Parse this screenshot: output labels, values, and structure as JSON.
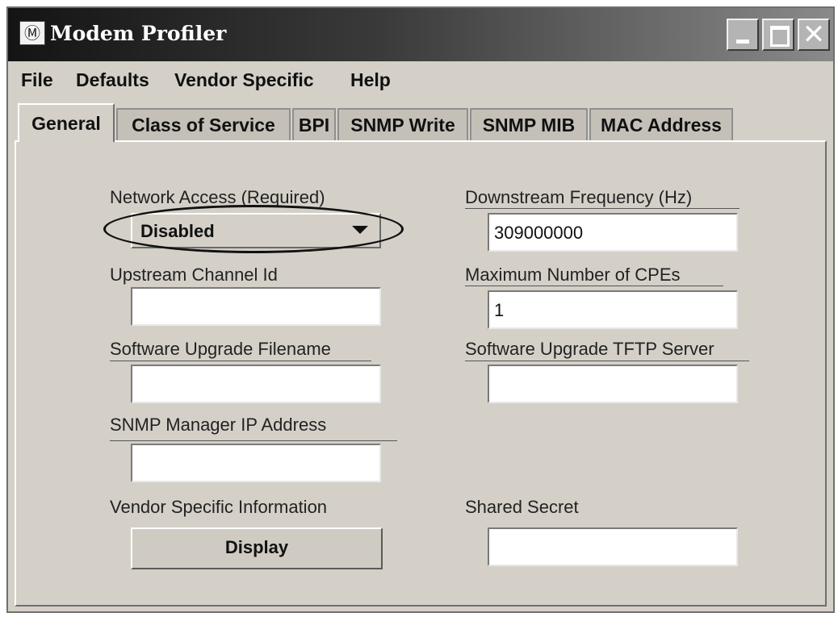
{
  "window": {
    "title": "Modem Profiler",
    "controls": {
      "minimize": "_",
      "maximize": "□",
      "close": "✕"
    },
    "icon": "motorola-logo-icon"
  },
  "menubar": {
    "items": [
      "File",
      "Defaults",
      "Vendor Specific",
      "Help"
    ]
  },
  "tabs": [
    {
      "label": "General",
      "active": true
    },
    {
      "label": "Class of Service",
      "active": false
    },
    {
      "label": "BPI",
      "active": false
    },
    {
      "label": "SNMP Write",
      "active": false
    },
    {
      "label": "SNMP MIB",
      "active": false
    },
    {
      "label": "MAC Address",
      "active": false
    }
  ],
  "general": {
    "network_access": {
      "label": "Network Access (Required)",
      "value": "Disabled",
      "highlighted": true
    },
    "downstream_frequency": {
      "label": "Downstream Frequency (Hz)",
      "value": "309000000"
    },
    "upstream_channel_id": {
      "label": "Upstream Channel Id",
      "value": ""
    },
    "max_cpes": {
      "label": "Maximum Number of CPEs",
      "value": "1"
    },
    "software_upgrade_filename": {
      "label": "Software Upgrade Filename",
      "value": ""
    },
    "software_upgrade_tftp_server": {
      "label": "Software Upgrade TFTP Server",
      "value": ""
    },
    "snmp_manager_ip": {
      "label": "SNMP Manager IP Address",
      "value": ""
    },
    "vendor_specific_info": {
      "label": "Vendor Specific Information",
      "button_label": "Display"
    },
    "shared_secret": {
      "label": "Shared Secret",
      "value": ""
    }
  },
  "colors": {
    "window_bg": "#d4d0c8",
    "titlebar_dark": "#141414",
    "titlebar_light": "#8a8a8a",
    "field_bg": "#ffffff"
  }
}
